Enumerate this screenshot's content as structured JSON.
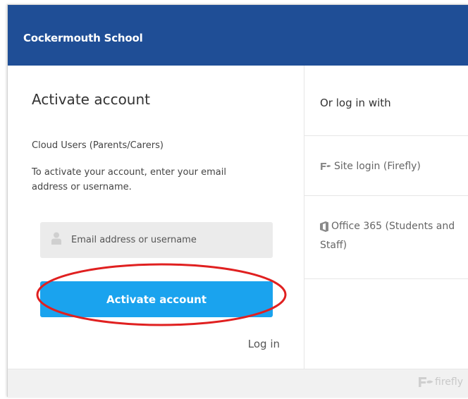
{
  "header": {
    "school_name": "Cockermouth School",
    "color": "#1f4e96"
  },
  "activate": {
    "heading": "Activate account",
    "subheading": "Cloud Users (Parents/Carers)",
    "instruction": "To activate your account, enter your email address or username.",
    "input": {
      "placeholder": "Email address or username",
      "value": "",
      "icon": "user-icon"
    },
    "button_label": "Activate account",
    "button_color": "#1aa3ee",
    "login_link": "Log in"
  },
  "providers": {
    "heading": "Or log in with",
    "items": [
      {
        "label": "Site login (Firefly)",
        "icon": "firefly-icon"
      },
      {
        "label": "Office 365 (Students and Staff)",
        "icon": "office-icon"
      }
    ]
  },
  "footer": {
    "brand": "firefly",
    "icon": "firefly-logo-icon"
  },
  "annotation": {
    "color": "#e02020"
  }
}
